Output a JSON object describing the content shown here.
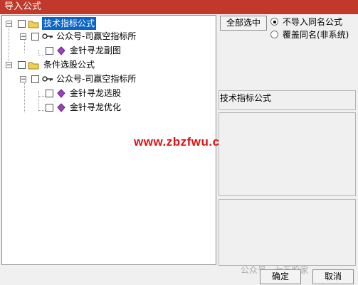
{
  "window": {
    "title": "导入公式"
  },
  "tree": [
    {
      "label": "技术指标公式",
      "selected": true,
      "level": 0,
      "type": "folder",
      "expander": "−"
    },
    {
      "label": "公众号-司赢空指标所",
      "level": 1,
      "type": "key",
      "expander": "−"
    },
    {
      "label": "金针寻龙副图",
      "level": 2,
      "type": "formula"
    },
    {
      "label": "条件选股公式",
      "level": 0,
      "type": "folder",
      "expander": "−"
    },
    {
      "label": "公众号-司赢空指标所",
      "level": 1,
      "type": "key",
      "expander": "−"
    },
    {
      "label": "金针寻龙选股",
      "level": 2,
      "type": "formula"
    },
    {
      "label": "金针寻龙优化",
      "level": 2,
      "type": "formula"
    }
  ],
  "buttons": {
    "select_all": "全部选中",
    "ok": "确定",
    "cancel": "取消"
  },
  "options": {
    "no_import_same_name": "不导入同名公式",
    "overwrite_same_name": "覆盖同名(非系统)",
    "selected": "no_import_same_name"
  },
  "info": {
    "title": "技术指标公式"
  },
  "watermark": "www.zbzfwu.com",
  "wechat_overlay": "公众号 · 七万股家",
  "colors": {
    "title_bar": "#c0392b",
    "selection": "#0a64c8",
    "watermark": "#e01010"
  },
  "icons": {
    "folder": "folder-icon",
    "key": "key-icon",
    "formula": "formula-icon"
  }
}
